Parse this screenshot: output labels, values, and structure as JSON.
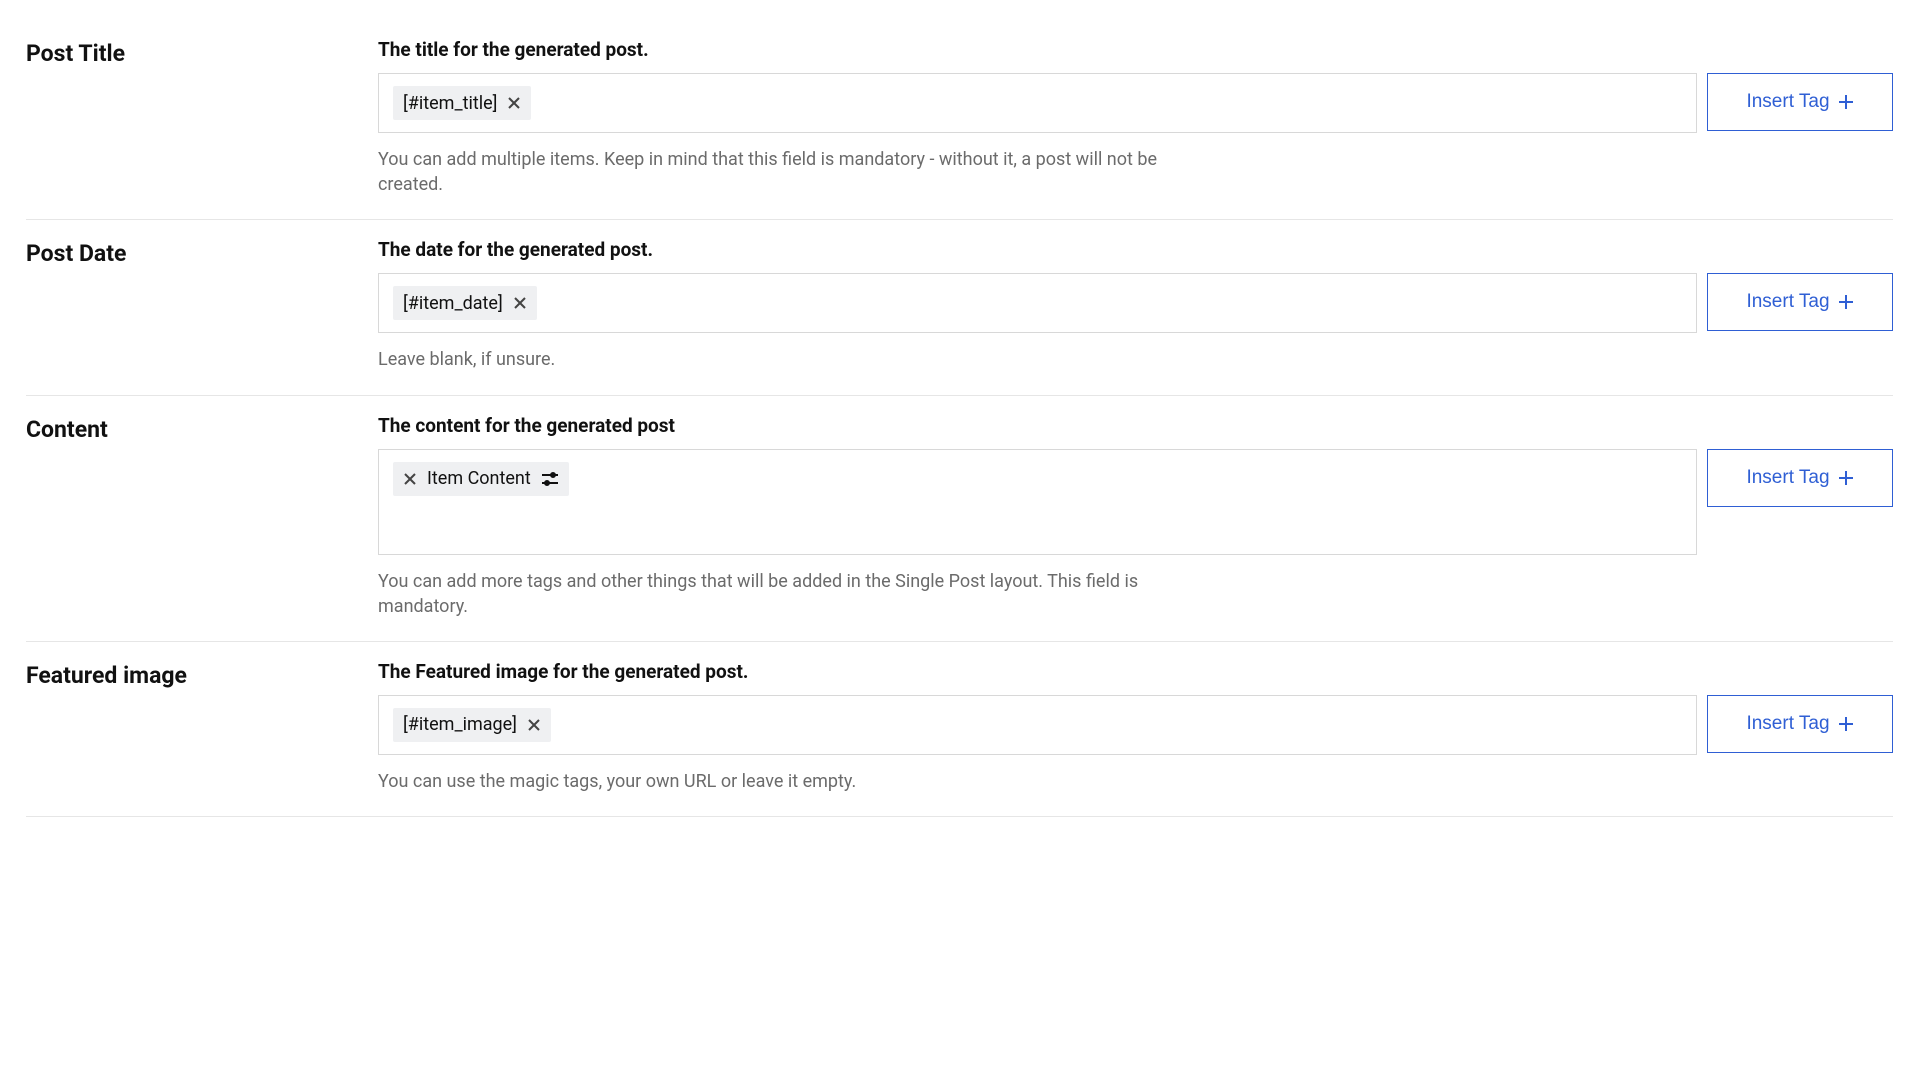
{
  "insert_tag_label": "Insert Tag",
  "sections": {
    "post_title": {
      "label": "Post Title",
      "sub": "The title for the generated post.",
      "chip": "[#item_title]",
      "helper": "You can add multiple items. Keep in mind that this field is mandatory - without it, a post will not be created."
    },
    "post_date": {
      "label": "Post Date",
      "sub": "The date for the generated post.",
      "chip": "[#item_date]",
      "helper": "Leave blank, if unsure."
    },
    "content": {
      "label": "Content",
      "sub": "The content for the generated post",
      "chip": "Item Content",
      "helper": "You can add more tags and other things that will be added in the Single Post layout. This field is mandatory."
    },
    "featured_image": {
      "label": "Featured image",
      "sub": "The Featured image for the generated post.",
      "chip": "[#item_image]",
      "helper": "You can use the magic tags, your own URL or leave it empty."
    }
  }
}
